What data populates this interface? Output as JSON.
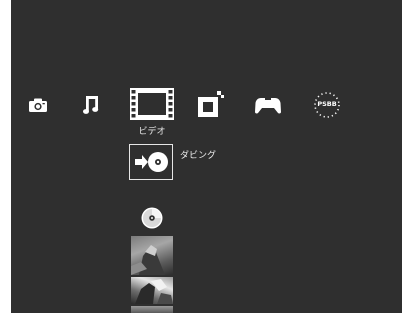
{
  "xmb": {
    "categories": [
      {
        "id": "photo",
        "icon": "camera-icon"
      },
      {
        "id": "music",
        "icon": "music-note-icon"
      },
      {
        "id": "video",
        "icon": "film-strip-icon",
        "label": "ビデオ",
        "selected": true
      },
      {
        "id": "game",
        "icon": "game-icon"
      },
      {
        "id": "controller",
        "icon": "controller-icon"
      },
      {
        "id": "psbb",
        "icon": "psbb-icon",
        "text": "PSBB"
      }
    ],
    "selected_item": {
      "icon": "dubbing-icon",
      "label": "ダビング"
    },
    "below_items": [
      {
        "icon": "disc-icon"
      },
      {
        "icon": "video-thumbnail"
      },
      {
        "icon": "video-thumbnail"
      },
      {
        "icon": "video-thumbnail"
      }
    ],
    "colors": {
      "background": "#2f2f2f",
      "icon": "#ffffff",
      "label": "#e8e8e8"
    }
  }
}
